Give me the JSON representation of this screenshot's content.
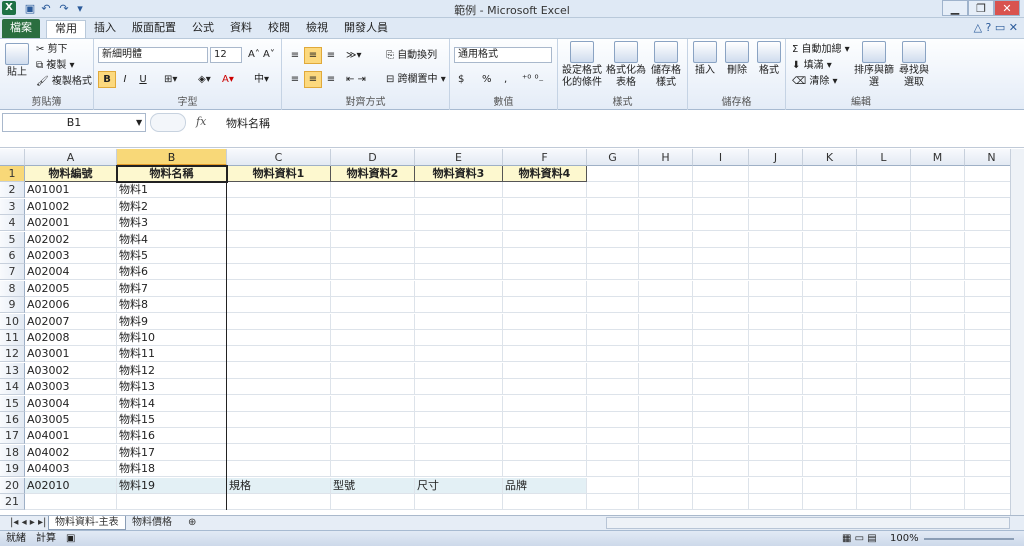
{
  "window": {
    "title": "範例 - Microsoft Excel"
  },
  "tabs": [
    "檔案",
    "常用",
    "插入",
    "版面配置",
    "公式",
    "資料",
    "校閱",
    "檢視",
    "開發人員"
  ],
  "ribbon": {
    "clipboard": {
      "paste": "貼上",
      "cut": "剪下",
      "copy": "複製",
      "format_painter": "複製格式",
      "label": "剪貼簿"
    },
    "font": {
      "name": "新細明體",
      "size": "12",
      "label": "字型",
      "bold": "B",
      "italic": "I",
      "underline": "U"
    },
    "alignment": {
      "wrap": "自動換列",
      "merge": "跨欄置中",
      "label": "對齊方式"
    },
    "number": {
      "format": "通用格式",
      "currency": "$",
      "percent": "%",
      "comma": ",",
      "label": "數值"
    },
    "styles": {
      "conditional": "設定格式化的條件",
      "table": "格式化為表格",
      "cell_styles": "儲存格樣式",
      "label": "樣式"
    },
    "cells": {
      "insert": "插入",
      "delete": "刪除",
      "format": "格式",
      "label": "儲存格"
    },
    "editing": {
      "autosum": "自動加總",
      "fill": "填滿",
      "clear": "清除",
      "sort": "排序與篩選",
      "find": "尋找與選取",
      "label": "編輯"
    }
  },
  "formula_bar": {
    "name_box": "B1",
    "fx": "fx",
    "value": "物料名稱"
  },
  "columns": [
    "A",
    "B",
    "C",
    "D",
    "E",
    "F",
    "G",
    "H",
    "I",
    "J",
    "K",
    "L",
    "M",
    "N"
  ],
  "rows": [
    [
      "物料編號",
      "物料名稱",
      "物料資料1",
      "物料資料2",
      "物料資料3",
      "物料資料4"
    ],
    [
      "A01001",
      "物料1",
      "",
      "",
      "",
      ""
    ],
    [
      "A01002",
      "物料2",
      "",
      "",
      "",
      ""
    ],
    [
      "A02001",
      "物料3",
      "",
      "",
      "",
      ""
    ],
    [
      "A02002",
      "物料4",
      "",
      "",
      "",
      ""
    ],
    [
      "A02003",
      "物料5",
      "",
      "",
      "",
      ""
    ],
    [
      "A02004",
      "物料6",
      "",
      "",
      "",
      ""
    ],
    [
      "A02005",
      "物料7",
      "",
      "",
      "",
      ""
    ],
    [
      "A02006",
      "物料8",
      "",
      "",
      "",
      ""
    ],
    [
      "A02007",
      "物料9",
      "",
      "",
      "",
      ""
    ],
    [
      "A02008",
      "物料10",
      "",
      "",
      "",
      ""
    ],
    [
      "A03001",
      "物料11",
      "",
      "",
      "",
      ""
    ],
    [
      "A03002",
      "物料12",
      "",
      "",
      "",
      ""
    ],
    [
      "A03003",
      "物料13",
      "",
      "",
      "",
      ""
    ],
    [
      "A03004",
      "物料14",
      "",
      "",
      "",
      ""
    ],
    [
      "A03005",
      "物料15",
      "",
      "",
      "",
      ""
    ],
    [
      "A04001",
      "物料16",
      "",
      "",
      "",
      ""
    ],
    [
      "A04002",
      "物料17",
      "",
      "",
      "",
      ""
    ],
    [
      "A04003",
      "物料18",
      "",
      "",
      "",
      ""
    ],
    [
      "A02010",
      "物料19",
      "規格",
      "型號",
      "尺寸",
      "品牌"
    ],
    [
      "",
      "",
      "",
      "",
      "",
      ""
    ]
  ],
  "sheets": [
    "物料資料-主表",
    "物料價格"
  ],
  "status": {
    "ready": "就緒",
    "calc": "計算",
    "zoom": "100%"
  },
  "colors": {
    "header_fill": "#fdf8cf",
    "highlight_row": "#e3f0f5",
    "file_tab": "#2a6e3f"
  }
}
